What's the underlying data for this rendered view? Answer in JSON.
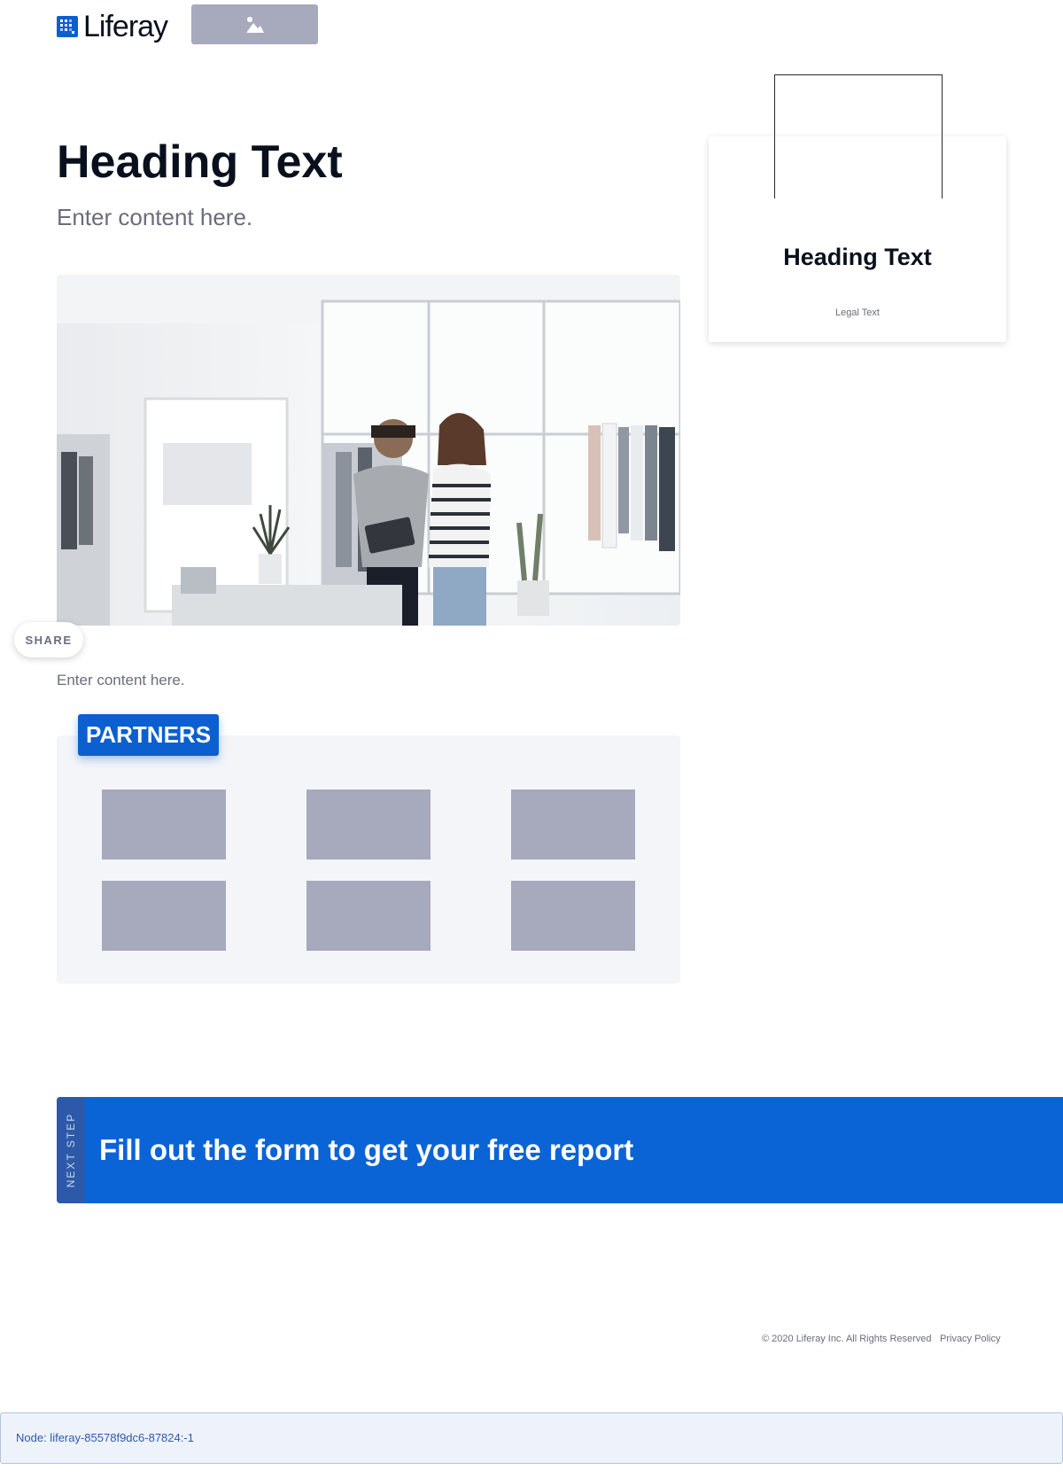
{
  "header": {
    "logo_text": "Liferay",
    "image_placeholder_icon": "image-icon"
  },
  "main": {
    "heading": "Heading Text",
    "subheading": "Enter content here.",
    "hero_image_icon": "photo-store-image",
    "share_label": "SHARE",
    "content_text": "Enter content here."
  },
  "partners": {
    "badge_label": "PARTNERS",
    "logo_count": 6
  },
  "card": {
    "heading": "Heading Text",
    "legal": "Legal Text"
  },
  "cta": {
    "tab_label": "NEXT STEP",
    "text": "Fill out the form to get your free report"
  },
  "footer": {
    "copyright": "© 2020 Liferay Inc. All Rights Reserved",
    "privacy": "Privacy Policy"
  },
  "node": {
    "text": "Node: liferay-85578f9dc6-87824:-1"
  },
  "colors": {
    "brand_blue": "#0b5fcf",
    "cta_blue": "#0b64d6",
    "placeholder_gray": "#a7a9bc",
    "panel_bg": "#f4f5f9"
  }
}
